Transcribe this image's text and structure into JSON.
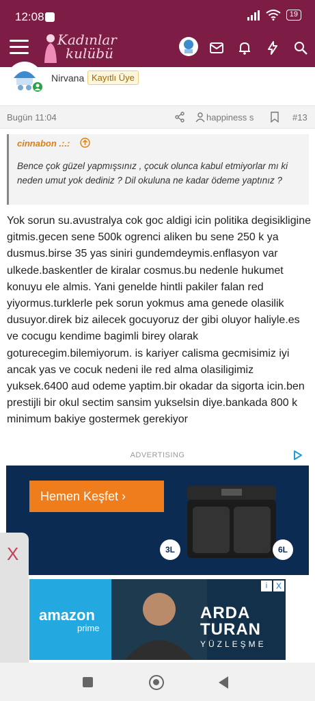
{
  "status_bar": {
    "time": "12:08",
    "battery": "19"
  },
  "header": {
    "logo_line1": "Kadınlar",
    "logo_line2": "kulübü",
    "icons": [
      "menu-icon",
      "avatar",
      "mail-icon",
      "bell-icon",
      "bolt-icon",
      "search-icon"
    ]
  },
  "post": {
    "author": "Nirvana",
    "badge": "Kayıtlı Üye",
    "date": "Bugün 11:04",
    "mentioned_user": "happiness s",
    "number": "#13",
    "quote": {
      "author": "cinnabon .:.:",
      "text": "Bence çok güzel yapmışsınız , çocuk olunca kabul etmiyorlar mı ki neden umut yok dediniz ? Dil okuluna ne kadar ödeme yaptınız ?"
    },
    "body": "Yok sorun su.avustralya cok goc aldigi icin politika degisikligine gitmis.gecen sene 500k ogrenci aliken bu sene 250 k ya dusmus.birse 35 yas siniri gundemdeymis.enflasyon var ulkede.baskentler de kiralar cosmus.bu nedenle hukumet konuyu ele almis. Yani genelde hintli pakiler falan red yiyormus.turklerle pek sorun yokmus ama genede olasilik dusuyor.direk biz ailecek gocuyoruz der gibi oluyor haliyle.es ve cocugu kendime bagimli birey olarak goturecegim.bilemiyorum. is kariyer calisma gecmisimiz iyi ancak yas ve cocuk nedeni ile red alma olasiligimiz yuksek.6400 aud odeme yaptim.bir okadar da sigorta icin.ben prestijli bir okul sectim sansim yukselsin diye.bankada 800 k minimum bakiye gostermek gerekiyor"
  },
  "ads": {
    "label": "ADVERTISING",
    "banner": {
      "cta": "Hemen Keşfet  ›",
      "size_left": "3L",
      "size_right": "6L"
    },
    "side_close": "X",
    "bottom": {
      "brand": "amazon",
      "brand_sub": "prime",
      "title_line1": "ARDA",
      "title_line2": "TURAN",
      "subtitle": "YÜZLEŞME",
      "info": "i",
      "close": "X"
    }
  },
  "colors": {
    "header": "#7d1d45",
    "quote_author": "#e07d12",
    "badge_text": "#a06a00",
    "ad_cta": "#ef7d1c"
  }
}
